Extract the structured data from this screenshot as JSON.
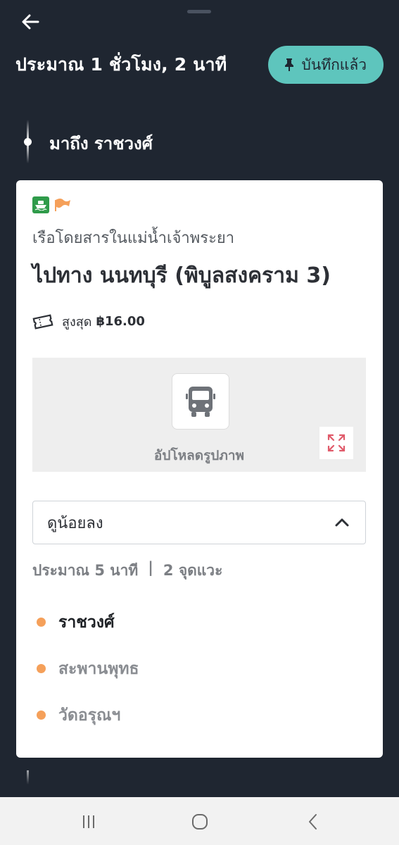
{
  "header": {
    "duration": "ประมาณ 1 ชั่วโมง, 2 นาที",
    "saved_label": "บันทึกแล้ว",
    "back_icon": "arrow-left-icon",
    "pin_icon": "pin-icon"
  },
  "timeline": {
    "arrive_label": "มาถึง ราชวงศ์"
  },
  "card": {
    "mode_icon": "boat-icon",
    "flag_icon": "flag-icon",
    "service_name": "เรือโดยสารในแม่น้ำเจ้าพระยา",
    "direction": "ไปทาง นนทบุรี (พิบูลสงคราม 3)",
    "fare_icon": "ticket-icon",
    "fare_label": "สูงสุด",
    "fare_value": "฿16.00",
    "photo": {
      "icon": "bus-icon",
      "upload_label": "อัปโหลดรูปภาพ",
      "expand_icon": "expand-icon"
    },
    "collapse": {
      "label": "ดูน้อยลง",
      "icon": "chevron-up-icon"
    },
    "summary": {
      "time": "ประมาณ 5 นาที",
      "separator": "|",
      "stops_count": "2 จุดแวะ"
    },
    "stops": [
      {
        "name": "ราชวงศ์"
      },
      {
        "name": "สะพานพุทธ"
      },
      {
        "name": "วัดอรุณฯ"
      }
    ]
  },
  "colors": {
    "background": "#1f2631",
    "accent": "#5ec5bd",
    "stop_dot": "#f5a05a",
    "mode_badge": "#2f9b4a",
    "flag": "#f5a05a"
  },
  "navbar": {
    "recents_icon": "recent-apps-icon",
    "home_icon": "home-icon",
    "back_icon": "nav-back-icon"
  }
}
